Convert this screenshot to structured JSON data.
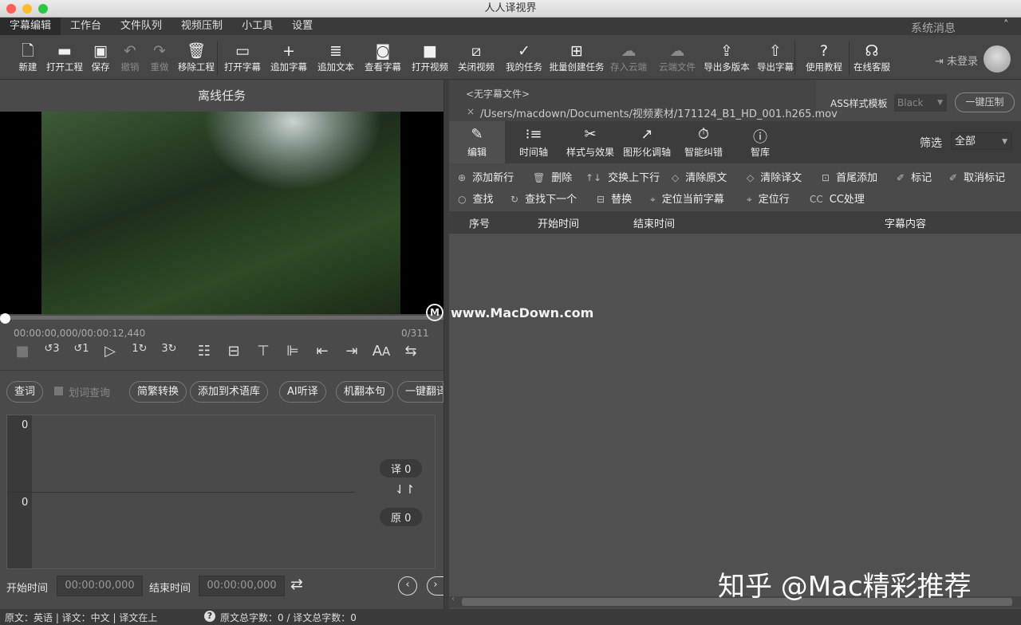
{
  "window": {
    "title": "人人译视界"
  },
  "menu": {
    "items": [
      "字幕编辑",
      "工作台",
      "文件队列",
      "视频压制",
      "小工具",
      "设置"
    ],
    "system_message": "系统消息"
  },
  "toolbar": {
    "items": [
      {
        "label": "新建",
        "icon": "new-file-icon",
        "glyph": "🗋"
      },
      {
        "label": "打开工程",
        "icon": "folder-icon",
        "glyph": "▬"
      },
      {
        "label": "保存",
        "icon": "save-icon",
        "glyph": "▣"
      },
      {
        "label": "撤销",
        "icon": "undo-icon",
        "glyph": "↶",
        "disabled": true
      },
      {
        "label": "重做",
        "icon": "redo-icon",
        "glyph": "↷",
        "disabled": true
      },
      {
        "label": "移除工程",
        "icon": "trash-icon",
        "glyph": "🗑"
      },
      {
        "label": "打开字幕",
        "icon": "open-folder-icon",
        "glyph": "▭"
      },
      {
        "label": "追加字幕",
        "icon": "plus-icon",
        "glyph": "+"
      },
      {
        "label": "追加文本",
        "icon": "document-icon",
        "glyph": "≣"
      },
      {
        "label": "查看字幕",
        "icon": "search-doc-icon",
        "glyph": "◙"
      },
      {
        "label": "打开视频",
        "icon": "camera-icon",
        "glyph": "■"
      },
      {
        "label": "关闭视频",
        "icon": "camera-off-icon",
        "glyph": "⧄"
      },
      {
        "label": "我的任务",
        "icon": "clipboard-check-icon",
        "glyph": "✓"
      },
      {
        "label": "批量创建任务",
        "icon": "bag-plus-icon",
        "glyph": "⊞"
      },
      {
        "label": "存入云端",
        "icon": "cloud-icon",
        "glyph": "☁",
        "disabled": true
      },
      {
        "label": "云端文件",
        "icon": "cloud-upload-icon",
        "glyph": "☁",
        "disabled": true
      },
      {
        "label": "导出多版本",
        "icon": "layers-export-icon",
        "glyph": "⇪"
      },
      {
        "label": "导出字幕",
        "icon": "file-export-icon",
        "glyph": "⇧"
      },
      {
        "label": "使用教程",
        "icon": "help-icon",
        "glyph": "?"
      },
      {
        "label": "在线客服",
        "icon": "headset-icon",
        "glyph": "☊"
      }
    ],
    "login": "未登录"
  },
  "left": {
    "title": "离线任务",
    "time": "00:00:00,000/00:00:12,440",
    "frame_count": "0/311",
    "progress": 0,
    "buttons": [
      "查词",
      "简繁转换",
      "添加到术语库",
      "AI听译",
      "机翻本句",
      "一键翻译"
    ],
    "word_lookup": "划词查询",
    "top_count": "0",
    "bottom_count": "0",
    "translated_badge": "译 0",
    "original_badge": "原 0",
    "start_label": "开始时间",
    "start_value": "00:00:00,000",
    "end_label": "结束时间",
    "end_value": "00:00:00,000"
  },
  "right": {
    "no_sub": "<无字幕文件>",
    "file_path": "/Users/macdown/Documents/视频素材/171124_B1_HD_001.h265.mov",
    "close": "×",
    "ass_label": "ASS样式模板",
    "ass_value": "Black",
    "burn_button": "一键压制",
    "tabs": [
      {
        "label": "编辑",
        "glyph": "✎"
      },
      {
        "label": "时间轴",
        "glyph": "⁝≡"
      },
      {
        "label": "样式与效果",
        "glyph": "✂"
      },
      {
        "label": "图形化调轴",
        "glyph": "↗"
      },
      {
        "label": "智能纠错",
        "glyph": "⏱"
      },
      {
        "label": "智库",
        "glyph": "ⓘ"
      }
    ],
    "filter_label": "筛选",
    "filter_value": "全部",
    "actions_row1": [
      {
        "label": "添加新行",
        "glyph": "⊕"
      },
      {
        "label": "删除",
        "glyph": "🗑"
      },
      {
        "label": "交换上下行",
        "glyph": "↑↓"
      },
      {
        "label": "清除原文",
        "glyph": "◇"
      },
      {
        "label": "清除译文",
        "glyph": "◇"
      },
      {
        "label": "首尾添加",
        "glyph": "⊡"
      },
      {
        "label": "标记",
        "glyph": "✐"
      },
      {
        "label": "取消标记",
        "glyph": "✐"
      }
    ],
    "actions_row2": [
      {
        "label": "查找",
        "glyph": "○"
      },
      {
        "label": "查找下一个",
        "glyph": "↻"
      },
      {
        "label": "替换",
        "glyph": "⊟"
      },
      {
        "label": "定位当前字幕",
        "glyph": "⌖"
      },
      {
        "label": "定位行",
        "glyph": "⌖"
      },
      {
        "label": "CC处理",
        "glyph": "CC"
      }
    ],
    "columns": [
      "序号",
      "开始时间",
      "结束时间",
      "字幕内容"
    ]
  },
  "status": {
    "lang": "原文：英语 | 译文：中文 | 译文在上",
    "counts": "原文总字数：0 / 译文总字数：0"
  },
  "watermarks": {
    "site": "www.MacDown.com",
    "zhihu": "知乎 @Mac精彩推荐"
  }
}
